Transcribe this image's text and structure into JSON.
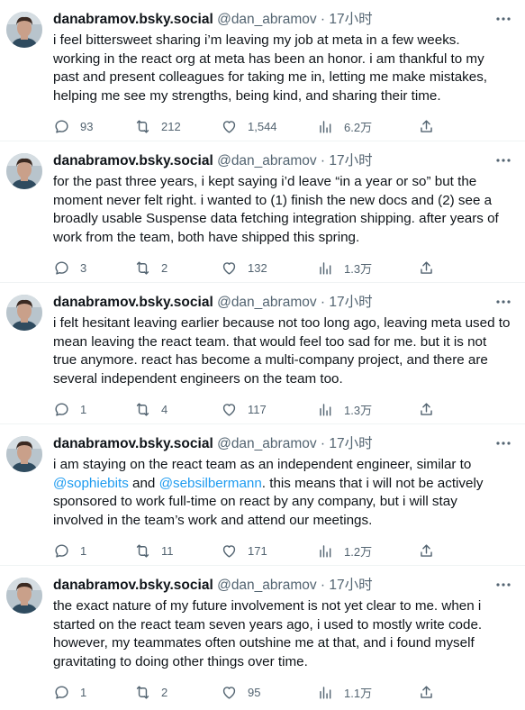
{
  "tweets": [
    {
      "name": "danabramov.bsky.social",
      "handle": "@dan_abramov",
      "separator": "·",
      "time": "17小时",
      "segments": [
        {
          "text": "i feel bittersweet sharing i’m leaving my job at meta in a few weeks.\nworking in the react org at meta has been an honor. i am thankful to my\npast and present colleagues for taking me in, letting me make mistakes,\nhelping me see my strengths, being kind, and sharing their time.",
          "mention": false
        }
      ],
      "replies": "93",
      "retweets": "212",
      "likes": "1,544",
      "views": "6.2万"
    },
    {
      "name": "danabramov.bsky.social",
      "handle": "@dan_abramov",
      "separator": "·",
      "time": "17小时",
      "segments": [
        {
          "text": "for the past three years, i kept saying i’d leave “in a year or so” but the\nmoment never felt right. i wanted to (1) finish the new docs and (2) see a\nbroadly usable Suspense data fetching integration shipping. after years of\nwork from the team, both have shipped this spring.",
          "mention": false
        }
      ],
      "replies": "3",
      "retweets": "2",
      "likes": "132",
      "views": "1.3万"
    },
    {
      "name": "danabramov.bsky.social",
      "handle": "@dan_abramov",
      "separator": "·",
      "time": "17小时",
      "segments": [
        {
          "text": "i felt hesitant leaving earlier because not too long ago, leaving meta used to\nmean leaving the react team. that would feel too sad for me. but it is not\ntrue anymore. react has become a multi-company project, and there are\nseveral independent engineers on the team too.",
          "mention": false
        }
      ],
      "replies": "1",
      "retweets": "4",
      "likes": "117",
      "views": "1.3万"
    },
    {
      "name": "danabramov.bsky.social",
      "handle": "@dan_abramov",
      "separator": "·",
      "time": "17小时",
      "segments": [
        {
          "text": "i am staying on the react team as an independent engineer, similar to\n",
          "mention": false
        },
        {
          "text": "@sophiebits",
          "mention": true
        },
        {
          "text": " and ",
          "mention": false
        },
        {
          "text": "@sebsilbermann",
          "mention": true
        },
        {
          "text": ". this means that i will not be actively\nsponsored to work full-time on react by any company, but i will stay\ninvolved in the team’s work and attend our meetings.",
          "mention": false
        }
      ],
      "replies": "1",
      "retweets": "11",
      "likes": "171",
      "views": "1.2万"
    },
    {
      "name": "danabramov.bsky.social",
      "handle": "@dan_abramov",
      "separator": "·",
      "time": "17小时",
      "segments": [
        {
          "text": "the exact nature of my future involvement is not yet clear to me. when i\nstarted on the react team seven years ago, i used to mostly write code.\nhowever, my teammates often outshine me at that, and i found myself\ngravitating to doing other things over time.",
          "mention": false
        }
      ],
      "replies": "1",
      "retweets": "2",
      "likes": "95",
      "views": "1.1万"
    }
  ],
  "icons": {
    "reply": "reply-icon",
    "retweet": "retweet-icon",
    "like": "heart-icon",
    "views": "views-chart-icon",
    "share": "share-icon",
    "more": "more-dots-icon"
  },
  "colors": {
    "text": "#0f1419",
    "secondary": "#536471",
    "link": "#1d9bf0",
    "divider": "#eff3f4"
  }
}
